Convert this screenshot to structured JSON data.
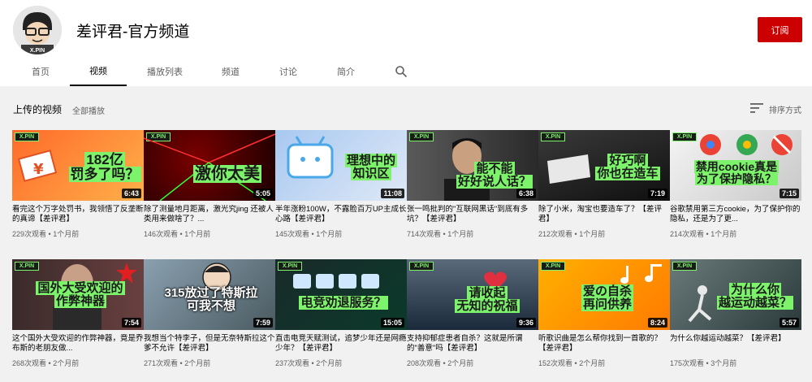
{
  "channel": {
    "name": "差评君-官方频道",
    "avatar_text": "X.PIN",
    "subscribe_label": "订阅"
  },
  "tabs": [
    {
      "label": "首页",
      "active": false
    },
    {
      "label": "视频",
      "active": true
    },
    {
      "label": "播放列表",
      "active": false
    },
    {
      "label": "频道",
      "active": false
    },
    {
      "label": "讨论",
      "active": false
    },
    {
      "label": "简介",
      "active": false
    }
  ],
  "section": {
    "title": "上传的视频",
    "play_all": "全部播放",
    "sort_label": "排序方式"
  },
  "colors": {
    "brand_green": "#7cf36a",
    "subscribe_red": "#cc0000"
  },
  "videos": [
    {
      "thumb_tag": "X.PIN",
      "thumb_text": "182亿 罚多了吗？",
      "duration": "6:43",
      "title": "看完这个万字处罚书，我领悟了反垄断的真谛【差评君】",
      "views": "229次观看",
      "age": "1个月前"
    },
    {
      "thumb_tag": "X.PIN",
      "thumb_text": "激你太美",
      "duration": "5:05",
      "title": "除了测量地月距离，激光究jing 还被人类用来做啥了？...",
      "views": "146次观看",
      "age": "1个月前"
    },
    {
      "thumb_tag": "",
      "thumb_text": "理想中的 知识区",
      "duration": "11:08",
      "title": "半年涨粉100W，不露脸百万UP主成长心路【差评君】",
      "views": "145次观看",
      "age": "1个月前"
    },
    {
      "thumb_tag": "X.PIN",
      "thumb_text": "能不能 好好说人话？",
      "duration": "6:38",
      "title": "张一鸣批判的\"互联网黑话\"到底有多坑？【差评君】",
      "views": "714次观看",
      "age": "1个月前"
    },
    {
      "thumb_tag": "X.PIN",
      "thumb_text": "好巧啊 你也在造车",
      "duration": "7:19",
      "title": "除了小米，淘宝也要造车了？【差评君】",
      "views": "212次观看",
      "age": "1个月前"
    },
    {
      "thumb_tag": "X.PIN",
      "thumb_text": "禁用cookie真是 为了保护隐私？",
      "duration": "7:15",
      "title": "谷歌禁用第三方cookie，为了保护你的隐私，还是为了更...",
      "views": "214次观看",
      "age": "1个月前"
    },
    {
      "thumb_tag": "X.PIN",
      "thumb_text": "国外大受欢迎的 作弊神器",
      "duration": "7:54",
      "title": "这个国外大受欢迎的作弊神器，竟是乔布斯的老朋友做...",
      "views": "268次观看",
      "age": "2个月前"
    },
    {
      "thumb_tag": "",
      "thumb_text": "315放过了特斯拉 可我不想",
      "duration": "7:59",
      "title": "我想当个特李子，但是无奈特斯拉这个爹不允许【差评君】",
      "views": "271次观看",
      "age": "2个月前"
    },
    {
      "thumb_tag": "X.PIN",
      "thumb_text": "电竞劝退服务？",
      "duration": "15:05",
      "title": "直击电竞天赋测试，追梦少年还是网瘾少年？【差评君】",
      "views": "237次观看",
      "age": "2个月前"
    },
    {
      "thumb_tag": "X.PIN",
      "thumb_text": "请收起 无知的祝福",
      "duration": "9:36",
      "title": "支持抑郁症患者自杀？这就是所谓的\"善意\"吗【差评君】",
      "views": "208次观看",
      "age": "2个月前"
    },
    {
      "thumb_tag": "X.PIN",
      "thumb_text": "爱の自杀 再问供养",
      "duration": "8:24",
      "title": "听歌识曲是怎么帮你找到一首歌的？【差评君】",
      "views": "152次观看",
      "age": "2个月前"
    },
    {
      "thumb_tag": "X.PIN",
      "thumb_text": "为什么你 越运动越菜？",
      "duration": "5:57",
      "title": "为什么你越运动越菜？【差评君】",
      "views": "175次观看",
      "age": "3个月前"
    }
  ]
}
